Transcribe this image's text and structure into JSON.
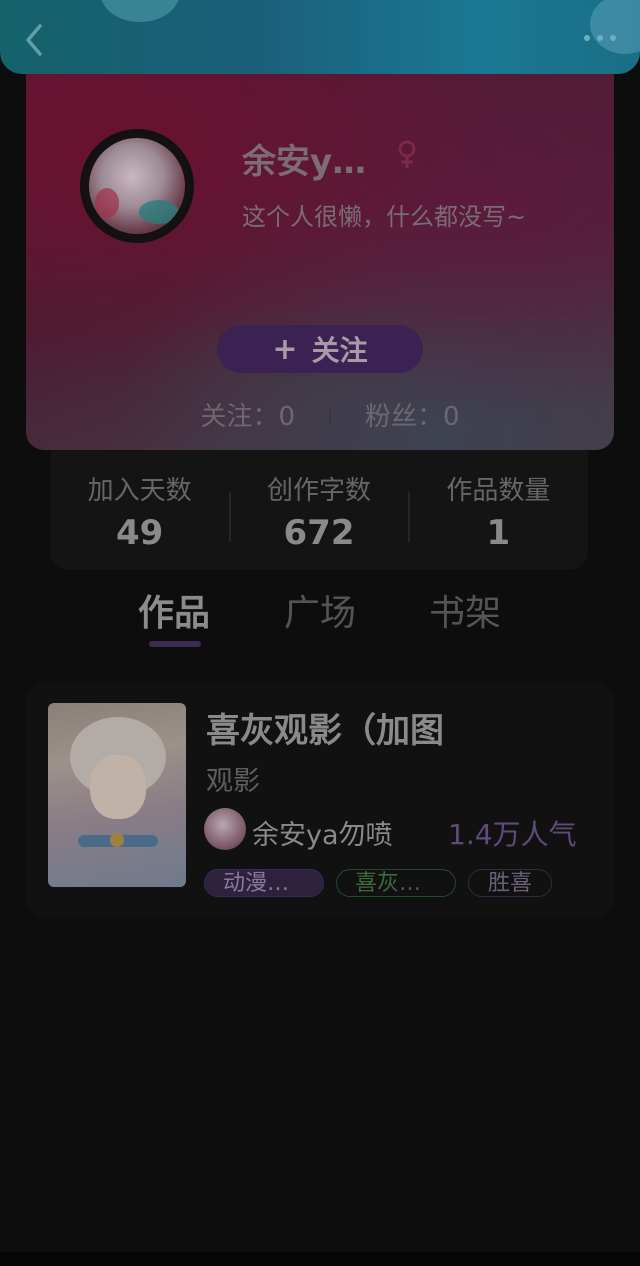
{
  "header": {
    "back_icon": "chevron-left-icon",
    "more_icon": "more-horizontal-icon"
  },
  "profile": {
    "nickname": "余安y…",
    "gender_icon": "female-icon",
    "bio": "这个人很懒，什么都没写~",
    "follow_button": {
      "icon": "+",
      "label": "关注"
    },
    "following_label": "关注：0",
    "followers_label": "粉丝：0"
  },
  "stats": [
    {
      "label": "加入天数",
      "value": "49"
    },
    {
      "label": "创作字数",
      "value": "672"
    },
    {
      "label": "作品数量",
      "value": "1"
    }
  ],
  "tabs": [
    {
      "label": "作品",
      "active": true
    },
    {
      "label": "广场",
      "active": false
    },
    {
      "label": "书架",
      "active": false
    }
  ],
  "works": [
    {
      "title": "喜灰观影（加图",
      "category": "观影",
      "author": "余安ya勿喷",
      "popularity": "1.4万人气",
      "tags": [
        "动漫…",
        "喜灰…",
        "胜喜"
      ]
    }
  ],
  "colors": {
    "background": "#0d0d0d",
    "topbar": "#1a6f86",
    "accent_purple": "#3b2252",
    "card_bg": "#111111"
  }
}
